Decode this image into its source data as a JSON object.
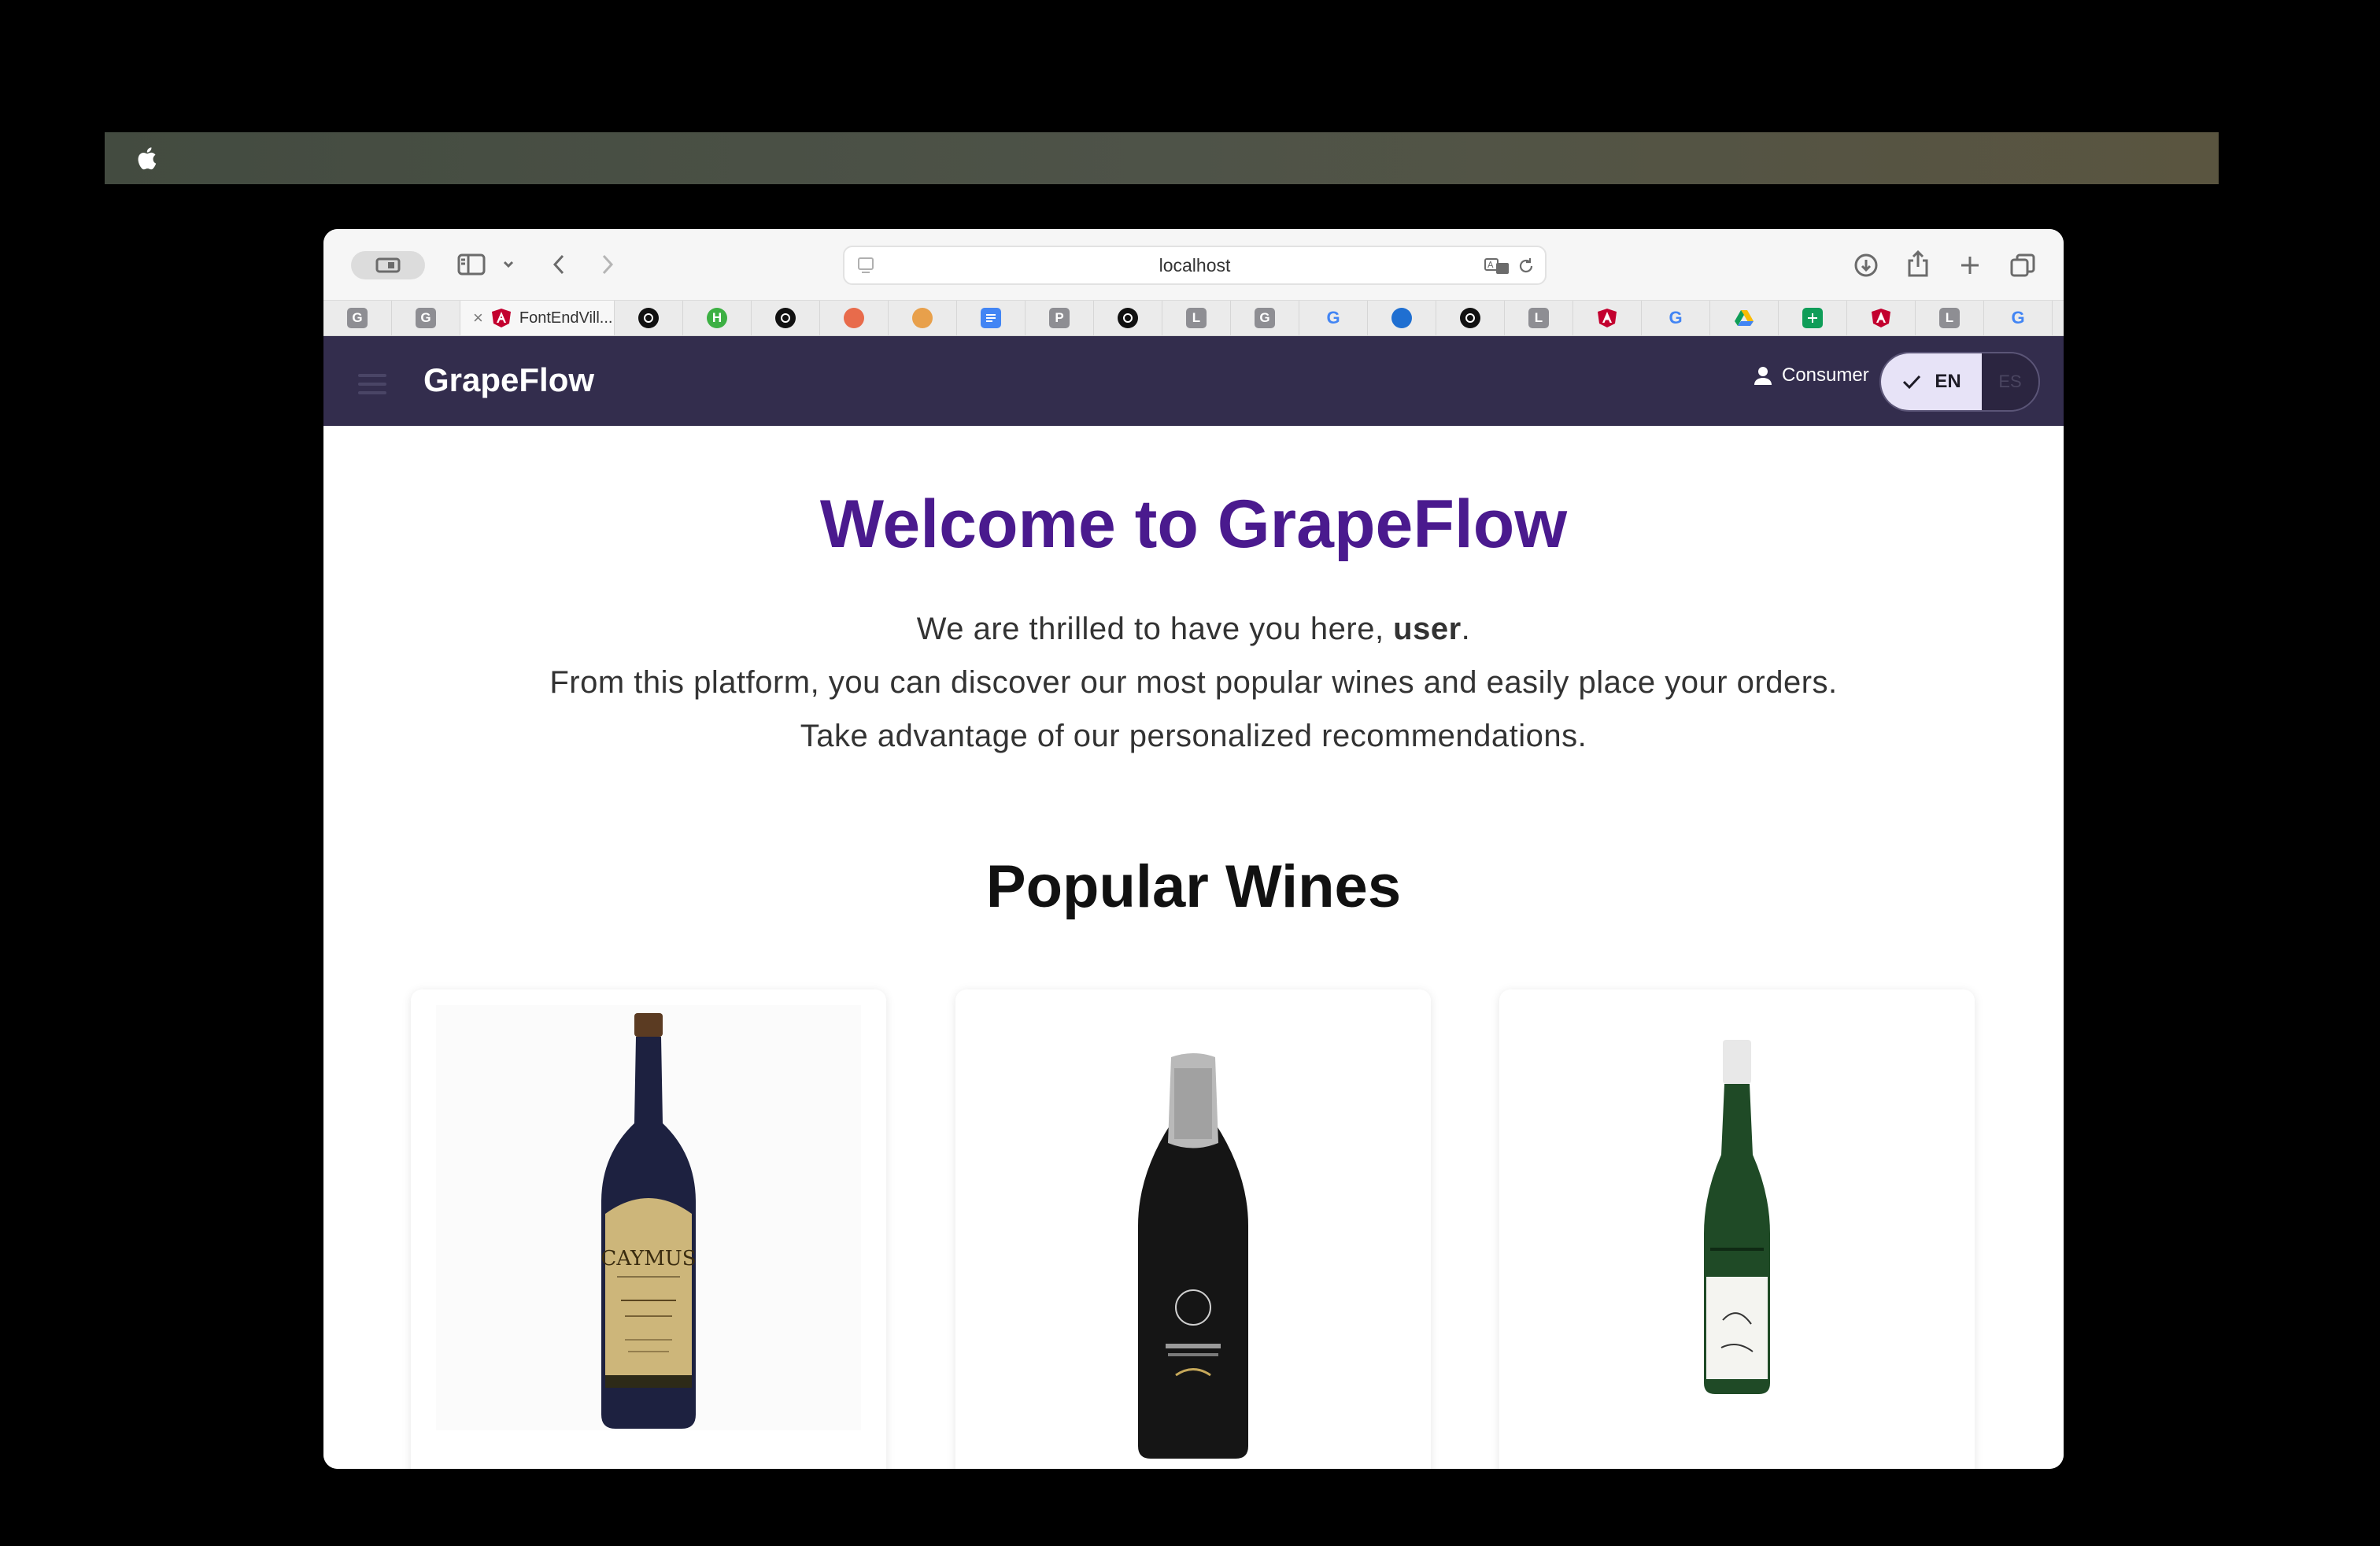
{
  "browser": {
    "url": "localhost",
    "active_tab_title": "FontEndVill...",
    "tabs": [
      {
        "icon": "g-letter-icon",
        "letter": "G",
        "color": "#8e8e93"
      },
      {
        "icon": "g-letter-icon",
        "letter": "G",
        "color": "#8e8e93"
      },
      {
        "icon": "angular-icon",
        "active": true
      },
      {
        "icon": "chatgpt-icon",
        "color": "#111111"
      },
      {
        "icon": "h-icon",
        "letter": "H",
        "color": "#3cb043"
      },
      {
        "icon": "github-icon",
        "color": "#111111"
      },
      {
        "icon": "chrome-like-icon",
        "color": "#e86b4b"
      },
      {
        "icon": "chrome-like-icon",
        "color": "#e8a04b"
      },
      {
        "icon": "docs-icon",
        "color": "#4285f4"
      },
      {
        "icon": "p-letter-icon",
        "letter": "P",
        "color": "#8e8e93"
      },
      {
        "icon": "github-icon",
        "color": "#111111"
      },
      {
        "icon": "l-letter-icon",
        "letter": "L",
        "color": "#8e8e93"
      },
      {
        "icon": "g-letter-icon",
        "letter": "G",
        "color": "#8e8e93"
      },
      {
        "icon": "google-icon",
        "letter": "G",
        "color": "#4285f4"
      },
      {
        "icon": "globe-icon",
        "color": "#1f6fd1"
      },
      {
        "icon": "openai-icon",
        "color": "#111111"
      },
      {
        "icon": "l-letter-icon",
        "letter": "L",
        "color": "#8e8e93"
      },
      {
        "icon": "angular-icon",
        "color": "#c3002f"
      },
      {
        "icon": "google-icon",
        "letter": "G",
        "color": "#4285f4"
      },
      {
        "icon": "drive-icon",
        "color": "#fbbc04"
      },
      {
        "icon": "sheets-icon",
        "color": "#0f9d58"
      },
      {
        "icon": "angular-icon",
        "color": "#c3002f"
      },
      {
        "icon": "l-letter-icon",
        "letter": "L",
        "color": "#8e8e93"
      },
      {
        "icon": "google-icon",
        "letter": "G",
        "color": "#4285f4"
      }
    ]
  },
  "app": {
    "brand": "GrapeFlow",
    "user_role": "Consumer",
    "lang_active": "EN",
    "lang_inactive": "ES",
    "header_color": "#332d4d"
  },
  "home": {
    "welcome_title": "Welcome to GrapeFlow",
    "greeting_prefix": "We are thrilled to have you here, ",
    "greeting_user": "user",
    "greeting_suffix": ".",
    "line2": "From this platform, you can discover our most popular wines and easily place your orders.",
    "line3": "Take advantage of our personalized recommendations.",
    "section_title": "Popular Wines",
    "wines": [
      {
        "image": "cabernet-bottle-image",
        "label_text": "CAYMUS"
      },
      {
        "image": "sparkling-bottle-image"
      },
      {
        "image": "riesling-bottle-image"
      }
    ]
  }
}
